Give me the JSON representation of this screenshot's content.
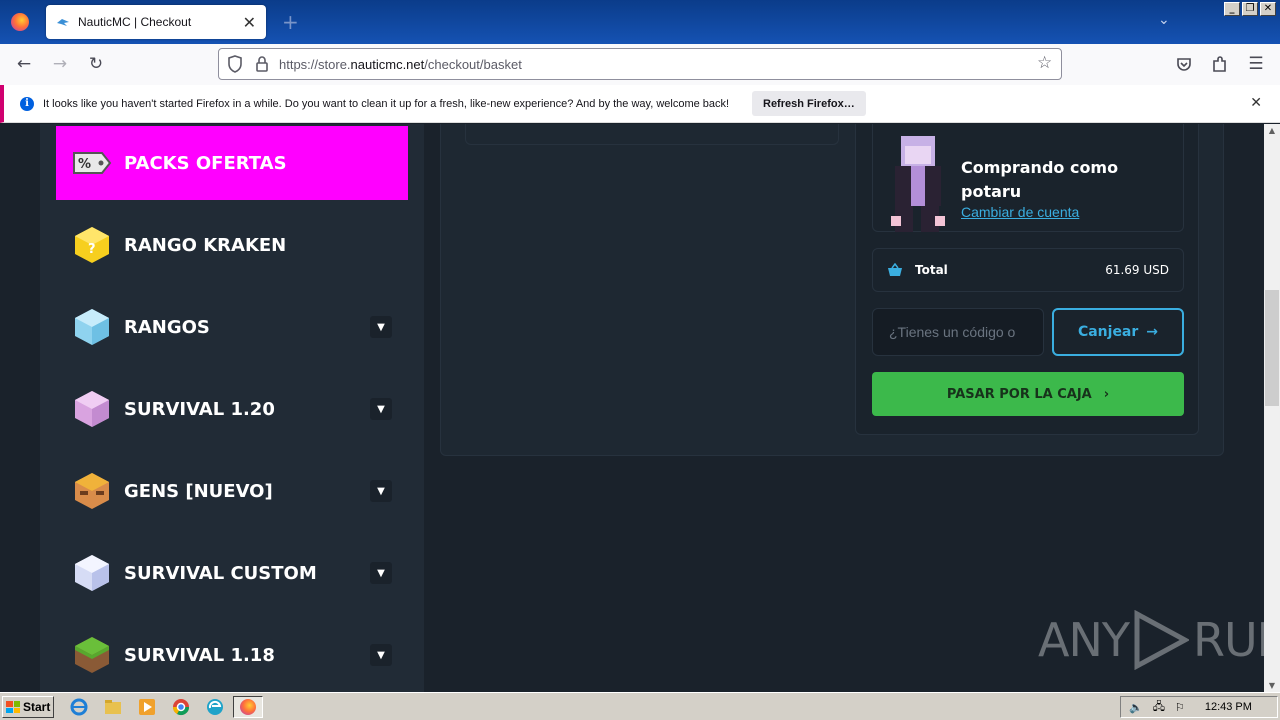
{
  "browser": {
    "tab_title": "NauticMC | Checkout",
    "url_prefix": "https://store.",
    "url_domain": "nauticmc.net",
    "url_path": "/checkout/basket"
  },
  "notification": {
    "text": "It looks like you haven't started Firefox in a while. Do you want to clean it up for a fresh, like-new experience? And by the way, welcome back!",
    "button": "Refresh Firefox…"
  },
  "sidebar": {
    "items": [
      {
        "label": "PACKS OFERTAS",
        "icon": "sale-tag-icon",
        "active": true,
        "has_caret": false
      },
      {
        "label": "RANGO KRAKEN",
        "icon": "lucky-block-icon",
        "has_caret": false
      },
      {
        "label": "RANGOS",
        "icon": "ice-block-icon",
        "has_caret": true
      },
      {
        "label": "SURVIVAL 1.20",
        "icon": "pink-block-icon",
        "has_caret": true
      },
      {
        "label": "GENS [NUEVO]",
        "icon": "gens-head-icon",
        "has_caret": true
      },
      {
        "label": "SURVIVAL CUSTOM",
        "icon": "crystal-block-icon",
        "has_caret": true
      },
      {
        "label": "SURVIVAL 1.18",
        "icon": "grass-block-icon",
        "has_caret": true
      }
    ]
  },
  "checkout": {
    "buyer_title": "Comprando como potaru",
    "change_account": "Cambiar de cuenta",
    "total_label": "Total",
    "total_value": "61.69 USD",
    "coupon_placeholder": "¿Tienes un código o",
    "redeem_label": "Canjear",
    "checkout_label": "PASAR POR LA CAJA"
  },
  "watermark": {
    "left": "ANY",
    "right": "RUN"
  },
  "taskbar": {
    "start": "Start",
    "clock": "12:43 PM"
  },
  "colors": {
    "accent_magenta": "#ff00ff",
    "link_blue": "#3aaee0",
    "checkout_green": "#3cb94b",
    "bg_dark": "#1a222b"
  }
}
